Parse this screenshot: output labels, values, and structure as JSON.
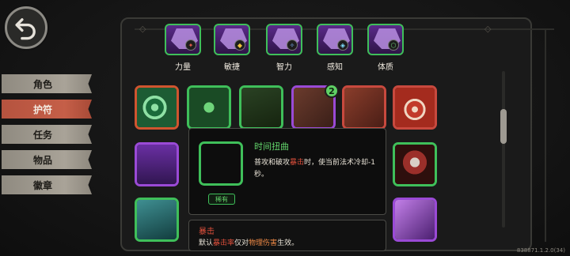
{
  "back_button": {
    "icon": "back-arrow-icon"
  },
  "tabs": [
    {
      "label": "角色",
      "active": false
    },
    {
      "label": "护符",
      "active": true
    },
    {
      "label": "任务",
      "active": false
    },
    {
      "label": "物品",
      "active": false
    },
    {
      "label": "徽章",
      "active": false
    }
  ],
  "stats": [
    {
      "label": "力量",
      "icon": "strength-icon"
    },
    {
      "label": "敏捷",
      "icon": "agility-icon"
    },
    {
      "label": "智力",
      "icon": "intelligence-icon"
    },
    {
      "label": "感知",
      "icon": "perception-icon"
    },
    {
      "label": "体质",
      "icon": "constitution-icon"
    }
  ],
  "runes": [
    {
      "icon": "swirl-rune-icon",
      "border": "#d0552f"
    },
    {
      "icon": "leaf-rune-icon",
      "border": "#3fbf5a"
    },
    {
      "icon": "mask-rune-icon",
      "border": "#3fbf5a"
    },
    {
      "icon": "blades-rune-icon",
      "border": "#9a4ad6",
      "badge": "2"
    },
    {
      "icon": "hands-rune-icon",
      "border": "#c8493e"
    },
    {
      "icon": "curl-rune-icon",
      "border": "#c8493e"
    },
    {
      "icon": "triangle-rune-icon",
      "border": "#9a4ad6"
    },
    {
      "icon": "demon-rune-icon",
      "border": "#3fbf5a"
    },
    {
      "icon": "wave-rune-icon",
      "border": "#3fbf5a"
    },
    {
      "icon": "violet-rune-icon",
      "border": "#9a4ad6"
    }
  ],
  "tooltip": {
    "title": "时间扭曲",
    "desc_before": "普攻和破攻",
    "desc_highlight": "暴击",
    "desc_after": "时，使当前法术冷却-1秒。",
    "rarity": "稀有",
    "icon": "time-warp-icon"
  },
  "glossary": {
    "title": "暴击",
    "desc_1": "默认",
    "desc_2": "暴击率",
    "desc_3": "仅对",
    "desc_4": "物理伤害",
    "desc_5": "生效。"
  },
  "version": "838871.1.2.0(34)",
  "colors": {
    "accent_green": "#3fbf5a",
    "accent_red": "#e0503c",
    "active_tab": "#c55f48"
  }
}
